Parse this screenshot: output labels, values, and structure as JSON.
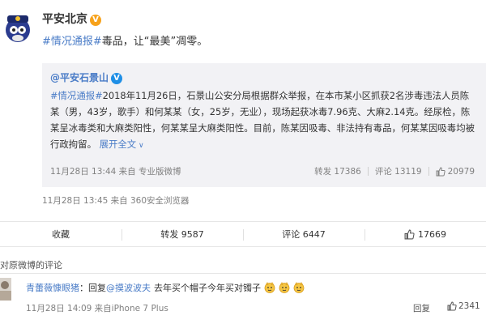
{
  "post": {
    "author": "平安北京",
    "topic": "#情况通报#",
    "text": "毒品，让“最美”凋零。",
    "meta": "11月28日 13:45 来自 360安全浏览器"
  },
  "repost": {
    "author": "@平安石景山",
    "topic": "#情况通报#",
    "body": "2018年11月26日，石景山公安分局根据群众举报，在本市某小区抓获2名涉毒违法人员陈某（男，43岁，歌手）和何某某（女，25岁，无业），现场起获冰毒7.96克、大麻2.14克。经尿检，陈某呈冰毒类和大麻类阳性，何某某呈大麻类阳性。目前，陈某因吸毒、非法持有毒品，何某某因吸毒均被行政拘留。",
    "expand": "展开全文",
    "meta": "11月28日 13:44 来自 专业版微博",
    "repost_label": "转发 17386",
    "comment_label": "评论 13119",
    "like_count": "20979"
  },
  "actions": {
    "collect": "收藏",
    "repost": "转发 9587",
    "comment": "评论 6447",
    "like": "17669"
  },
  "comments": {
    "header": "对原微博的评论",
    "items": [
      {
        "user": "青蕾薇慷眼猪",
        "text": "：回复",
        "mention": "@摸波波夫",
        "content": "去年买个帽子今年买对镯子",
        "meta": "11月28日 14:09 来自iPhone 7 Plus",
        "reply": "回复",
        "likes": "2341"
      }
    ]
  },
  "icons": {
    "verified": "verified-badge-icon",
    "like": "thumbs-up-icon",
    "emoji": "emoji-face-icon",
    "expand": "chevron-down-icon"
  },
  "colors": {
    "link": "#4a7cc7",
    "verified_gold": "#f7a21b",
    "verified_blue": "#1f8fe6",
    "repost_bg": "#f2f2f5"
  }
}
